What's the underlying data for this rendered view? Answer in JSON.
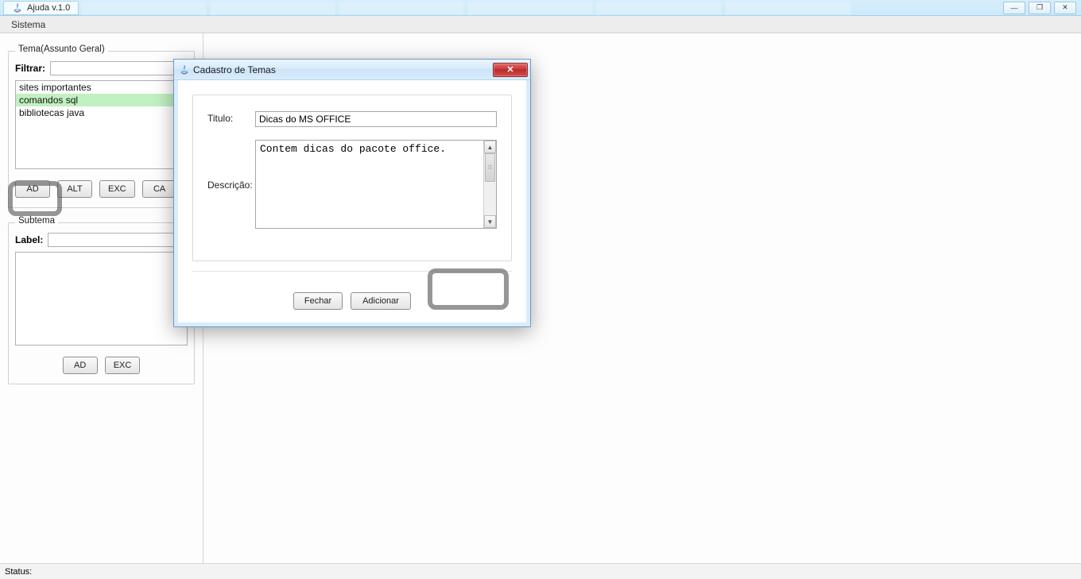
{
  "app": {
    "title": "Ajuda v.1.0"
  },
  "menu": {
    "sistema": "Sistema"
  },
  "sidebar": {
    "tema": {
      "legend": "Tema(Assunto Geral)",
      "filtrar_label": "Filtrar:",
      "filtrar_value": "",
      "items": [
        {
          "label": "sites importantes",
          "selected": false
        },
        {
          "label": "comandos sql",
          "selected": true
        },
        {
          "label": "bibliotecas java",
          "selected": false
        }
      ],
      "buttons": {
        "ad": "AD",
        "alt": "ALT",
        "exc": "EXC",
        "ca": "CA"
      }
    },
    "subtema": {
      "legend": "Subtema",
      "label_label": "Label:",
      "label_value": "",
      "buttons": {
        "ad": "AD",
        "exc": "EXC"
      }
    }
  },
  "dialog": {
    "title": "Cadastro de Temas",
    "titulo_label": "Titulo:",
    "titulo_value": "Dicas do MS OFFICE",
    "descricao_label": "Descrição:",
    "descricao_value": "Contem dicas do pacote office.",
    "fechar_label": "Fechar",
    "adicionar_label": "Adicionar"
  },
  "status": {
    "label": "Status:",
    "value": ""
  },
  "window_controls": {
    "min": "—",
    "max": "❐",
    "close": "✕"
  }
}
